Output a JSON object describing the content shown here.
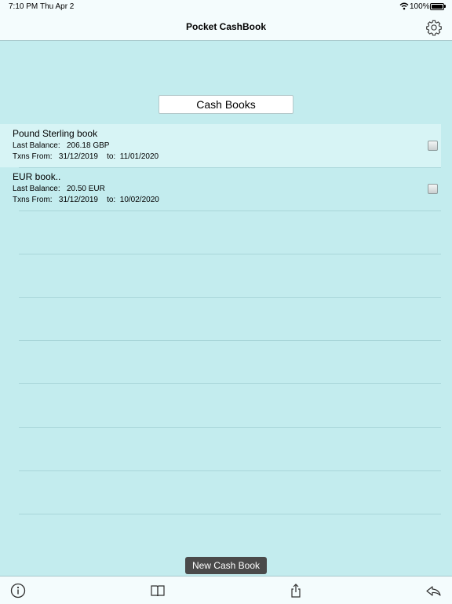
{
  "status": {
    "time": "7:10 PM",
    "date": "Thu Apr 2",
    "battery": "100%"
  },
  "nav": {
    "title": "Pocket CashBook",
    "settings_icon": "gear-icon"
  },
  "section": {
    "header": "Cash Books"
  },
  "books": [
    {
      "name": "Pound Sterling book",
      "balance_label": "Last Balance:",
      "balance": "206.18 GBP",
      "from_label": "Txns From:",
      "from": "31/12/2019",
      "to_label": "to:",
      "to": "11/01/2020",
      "selected": true
    },
    {
      "name": "EUR book..",
      "balance_label": "Last Balance:",
      "balance": "20.50 EUR",
      "from_label": "Txns From:",
      "from": "31/12/2019",
      "to_label": "to:",
      "to": "10/02/2020",
      "selected": false
    }
  ],
  "actions": {
    "new_book": "New Cash Book"
  },
  "toolbar": {
    "icons": [
      "info-icon",
      "book-icon",
      "share-icon",
      "back-arrow-icon"
    ]
  },
  "colors": {
    "background": "#c3ecee",
    "bar": "#f4fcfd",
    "selected_row": "#d7f4f5",
    "button": "#4a4a4a"
  }
}
